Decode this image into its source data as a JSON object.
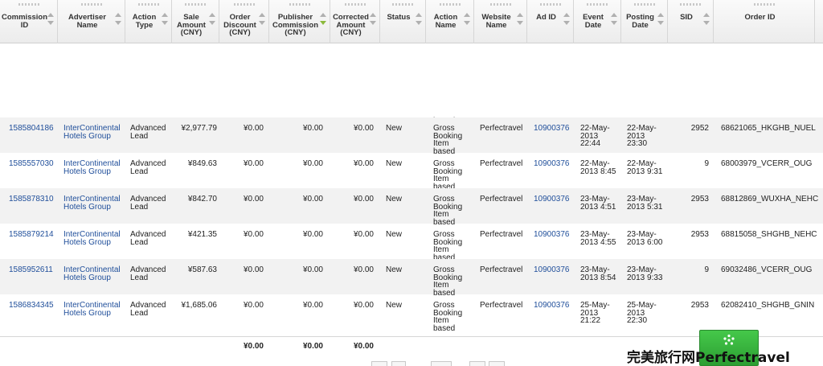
{
  "table": {
    "columns": [
      {
        "id": "commission_id",
        "label": "Commission ID",
        "lines": [
          "Commission",
          "ID"
        ]
      },
      {
        "id": "advertiser_name",
        "label": "Advertiser Name",
        "lines": [
          "Advertiser",
          "Name"
        ]
      },
      {
        "id": "action_type",
        "label": "Action Type",
        "lines": [
          "Action",
          "Type"
        ]
      },
      {
        "id": "sale_amount",
        "label": "Sale Amount (CNY)",
        "lines": [
          "Sale",
          "Amount",
          "(CNY)"
        ]
      },
      {
        "id": "order_discount",
        "label": "Order Discount (CNY)",
        "lines": [
          "Order",
          "Discount",
          "(CNY)"
        ]
      },
      {
        "id": "publisher_commission",
        "label": "Publisher Commission (CNY)",
        "lines": [
          "Publisher",
          "Commission",
          "(CNY)"
        ]
      },
      {
        "id": "corrected_amount",
        "label": "Corrected Amount (CNY)",
        "lines": [
          "Corrected",
          "Amount",
          "(CNY)"
        ]
      },
      {
        "id": "status",
        "label": "Status",
        "lines": [
          "Status"
        ]
      },
      {
        "id": "action_name",
        "label": "Action Name",
        "lines": [
          "Action",
          "Name"
        ]
      },
      {
        "id": "website_name",
        "label": "Website Name",
        "lines": [
          "Website",
          "Name"
        ]
      },
      {
        "id": "ad_id",
        "label": "Ad ID",
        "lines": [
          "Ad ID"
        ]
      },
      {
        "id": "event_date",
        "label": "Event Date",
        "lines": [
          "Event",
          "Date"
        ]
      },
      {
        "id": "posting_date",
        "label": "Posting Date",
        "lines": [
          "Posting",
          "Date"
        ]
      },
      {
        "id": "sid",
        "label": "SID",
        "lines": [
          "SID"
        ]
      },
      {
        "id": "order_id",
        "label": "Order ID",
        "lines": [
          "Order ID"
        ]
      }
    ],
    "active_sort_column": "publisher_commission",
    "overflow_text": [
      "based"
    ],
    "rows": [
      {
        "commission_id": "1585804186",
        "advertiser": [
          "InterContinental",
          "Hotels Group"
        ],
        "action_type": [
          "Advanced",
          "Lead"
        ],
        "sale_amount": "¥2,977.79",
        "order_discount": "¥0.00",
        "publisher_commission": "¥0.00",
        "corrected_amount": "¥0.00",
        "status": "New",
        "action_name": [
          "Gross",
          "Booking",
          "Item",
          "based"
        ],
        "website": "Perfectravel",
        "ad_id": "10900376",
        "event_date": [
          "22-May-",
          "2013",
          "22:44"
        ],
        "posting_date": [
          "22-May-",
          "2013",
          "23:30"
        ],
        "sid": "2952",
        "order_id": "68621065_HKGHB_NUEL"
      },
      {
        "commission_id": "1585557030",
        "advertiser": [
          "InterContinental",
          "Hotels Group"
        ],
        "action_type": [
          "Advanced",
          "Lead"
        ],
        "sale_amount": "¥849.63",
        "order_discount": "¥0.00",
        "publisher_commission": "¥0.00",
        "corrected_amount": "¥0.00",
        "status": "New",
        "action_name": [
          "Gross",
          "Booking",
          "Item",
          "based"
        ],
        "website": "Perfectravel",
        "ad_id": "10900376",
        "event_date": [
          "22-May-",
          "2013 8:45"
        ],
        "posting_date": [
          "22-May-",
          "2013 9:31"
        ],
        "sid": "9",
        "order_id": "68003979_VCERR_OUG"
      },
      {
        "commission_id": "1585878310",
        "advertiser": [
          "InterContinental",
          "Hotels Group"
        ],
        "action_type": [
          "Advanced",
          "Lead"
        ],
        "sale_amount": "¥842.70",
        "order_discount": "¥0.00",
        "publisher_commission": "¥0.00",
        "corrected_amount": "¥0.00",
        "status": "New",
        "action_name": [
          "Gross",
          "Booking",
          "Item",
          "based"
        ],
        "website": "Perfectravel",
        "ad_id": "10900376",
        "event_date": [
          "23-May-",
          "2013 4:51"
        ],
        "posting_date": [
          "23-May-",
          "2013 5:31"
        ],
        "sid": "2953",
        "order_id": "68812869_WUXHA_NEHC"
      },
      {
        "commission_id": "1585879214",
        "advertiser": [
          "InterContinental",
          "Hotels Group"
        ],
        "action_type": [
          "Advanced",
          "Lead"
        ],
        "sale_amount": "¥421.35",
        "order_discount": "¥0.00",
        "publisher_commission": "¥0.00",
        "corrected_amount": "¥0.00",
        "status": "New",
        "action_name": [
          "Gross",
          "Booking",
          "Item",
          "based"
        ],
        "website": "Perfectravel",
        "ad_id": "10900376",
        "event_date": [
          "23-May-",
          "2013 4:55"
        ],
        "posting_date": [
          "23-May-",
          "2013 6:00"
        ],
        "sid": "2953",
        "order_id": "68815058_SHGHB_NEHC"
      },
      {
        "commission_id": "1585952611",
        "advertiser": [
          "InterContinental",
          "Hotels Group"
        ],
        "action_type": [
          "Advanced",
          "Lead"
        ],
        "sale_amount": "¥587.63",
        "order_discount": "¥0.00",
        "publisher_commission": "¥0.00",
        "corrected_amount": "¥0.00",
        "status": "New",
        "action_name": [
          "Gross",
          "Booking",
          "Item",
          "based"
        ],
        "website": "Perfectravel",
        "ad_id": "10900376",
        "event_date": [
          "23-May-",
          "2013 8:54"
        ],
        "posting_date": [
          "23-May-",
          "2013 9:33"
        ],
        "sid": "9",
        "order_id": "69032486_VCERR_OUG"
      },
      {
        "commission_id": "1586834345",
        "advertiser": [
          "InterContinental",
          "Hotels Group"
        ],
        "action_type": [
          "Advanced",
          "Lead"
        ],
        "sale_amount": "¥1,685.06",
        "order_discount": "¥0.00",
        "publisher_commission": "¥0.00",
        "corrected_amount": "¥0.00",
        "status": "New",
        "action_name": [
          "Gross",
          "Booking",
          "Item",
          "based"
        ],
        "website": "Perfectravel",
        "ad_id": "10900376",
        "event_date": [
          "25-May-",
          "2013",
          "21:22"
        ],
        "posting_date": [
          "25-May-",
          "2013",
          "22:30"
        ],
        "sid": "2953",
        "order_id": "62082410_SHGHB_GNIN"
      }
    ],
    "totals": {
      "order_discount": "¥0.00",
      "publisher_commission": "¥0.00",
      "corrected_amount": "¥0.00"
    }
  },
  "widget": {
    "icon": "dots-cluster-icon"
  },
  "watermark": "完美旅行网Perfectravel",
  "colors": {
    "link": "#1f4e9a",
    "row_alt": "#f2f2f2",
    "sort_active": "#8bb93c",
    "button_green": "#3bb841"
  }
}
